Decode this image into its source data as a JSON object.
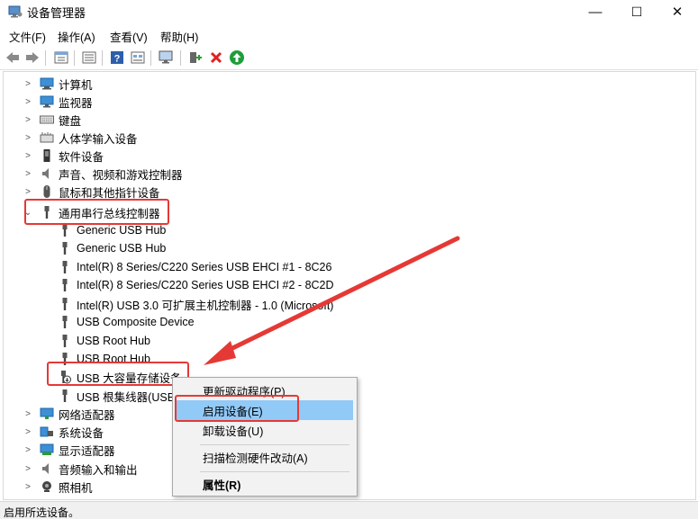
{
  "window": {
    "title": "设备管理器",
    "minimize": "—",
    "maximize": "☐",
    "close": "✕"
  },
  "menu": [
    "文件(F)",
    "操作(A)",
    "查看(V)",
    "帮助(H)"
  ],
  "toolbar": {
    "buttons": [
      "back-arrow-icon",
      "forward-arrow-icon",
      "properties-icon",
      "list-view-icon",
      "help-icon",
      "device-view-icon",
      "monitor-scan-icon",
      "add-driver-icon",
      "remove-device-icon",
      "update-driver-icon"
    ]
  },
  "tree": {
    "categories_top": [
      {
        "label": "计算机",
        "icon": "computer-icon"
      },
      {
        "label": "监视器",
        "icon": "monitor-icon"
      },
      {
        "label": "键盘",
        "icon": "keyboard-icon"
      },
      {
        "label": "人体学输入设备",
        "icon": "hid-icon"
      },
      {
        "label": "软件设备",
        "icon": "software-device-icon"
      },
      {
        "label": "声音、视频和游戏控制器",
        "icon": "speaker-icon"
      },
      {
        "label": "鼠标和其他指针设备",
        "icon": "mouse-icon"
      }
    ],
    "usb_category": {
      "label": "通用串行总线控制器",
      "icon": "usb-icon"
    },
    "usb_children": [
      "Generic USB Hub",
      "Generic USB Hub",
      "Intel(R) 8 Series/C220 Series USB EHCI #1 - 8C26",
      "Intel(R) 8 Series/C220 Series USB EHCI #2 - 8C2D",
      "Intel(R) USB 3.0 可扩展主机控制器 - 1.0 (Microsoft)",
      "USB Composite Device",
      "USB Root Hub",
      "USB Root Hub",
      "USB 大容量存储设备",
      "USB 根集线器(USB 3.0)"
    ],
    "categories_bottom": [
      {
        "label": "网络适配器",
        "icon": "network-icon"
      },
      {
        "label": "系统设备",
        "icon": "system-device-icon"
      },
      {
        "label": "显示适配器",
        "icon": "display-adapter-icon"
      },
      {
        "label": "音频输入和输出",
        "icon": "audio-icon"
      },
      {
        "label": "照相机",
        "icon": "camera-icon"
      }
    ]
  },
  "context_menu": {
    "items": [
      "更新驱动程序(P)",
      "启用设备(E)",
      "卸载设备(U)",
      "扫描检测硬件改动(A)",
      "属性(R)"
    ],
    "selected_index": 1
  },
  "status": "启用所选设备。",
  "colors": {
    "highlight_red": "#e53935",
    "menu_selected": "#91c9f7"
  }
}
